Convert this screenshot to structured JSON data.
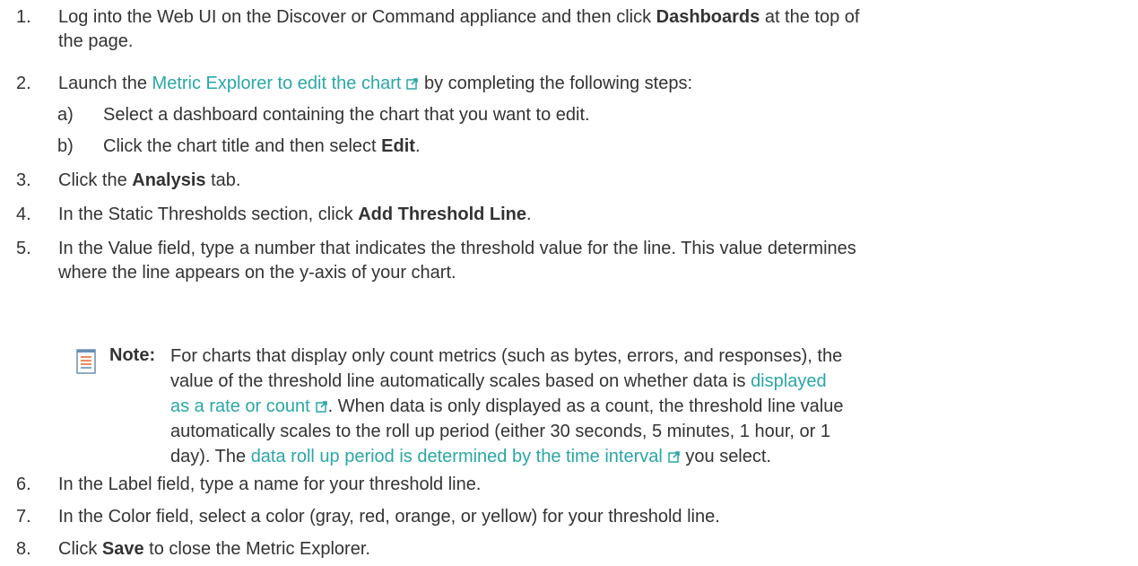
{
  "steps": [
    {
      "num": "1.",
      "pre": "Log into the Web UI on the Discover or Command appliance and then click ",
      "bold": "Dashboards",
      "post": " at the top of",
      "line2": "the page."
    },
    {
      "num": "2.",
      "pre": "Launch the ",
      "link": "Metric Explorer to edit the chart",
      "post": " by completing the following steps:"
    },
    {
      "num": "3.",
      "pre": "Click the ",
      "bold": "Analysis",
      "post": " tab."
    },
    {
      "num": "4.",
      "pre": "In the Static Thresholds section, click ",
      "bold": "Add Threshold Line",
      "post": "."
    },
    {
      "num": "5.",
      "line1": "In the Value field, type a number that indicates the threshold value for the line. This value determines",
      "line2": "where the line appears on the y-axis of your chart."
    },
    {
      "num": "6.",
      "text": "In the Label field, type a name for your threshold line."
    },
    {
      "num": "7.",
      "text": "In the Color field, select a color (gray, red, orange, or yellow) for your threshold line."
    },
    {
      "num": "8.",
      "pre": "Click ",
      "bold": "Save",
      "post": " to close the Metric Explorer."
    }
  ],
  "substeps": [
    {
      "letter": "a)",
      "text": "Select a dashboard containing the chart that you want to edit."
    },
    {
      "letter": "b)",
      "pre": "Click the chart title and then select ",
      "bold": "Edit",
      "post": "."
    }
  ],
  "note": {
    "label": "Note:",
    "l1": "For charts that display only count metrics (such as bytes, errors, and responses), the",
    "l2_pre": "value of the threshold line automatically scales based on whether data is ",
    "l2_link": "displayed",
    "l3_link": "as a rate or count",
    "l3_post": ". When data is only displayed as a count, the threshold line value",
    "l4": "automatically scales to the roll up period (either 30 seconds, 5 minutes, 1 hour, or 1",
    "l5_pre": "day). The ",
    "l5_link": "data roll up period is determined by the time interval",
    "l5_post": " you select."
  },
  "colors": {
    "text": "#333333",
    "link": "#2ba6a6",
    "note_icon_lines": "#e8703a",
    "note_icon_frame": "#6a8fb5"
  },
  "icons": {
    "external": "external-link-icon",
    "note": "note-icon"
  }
}
